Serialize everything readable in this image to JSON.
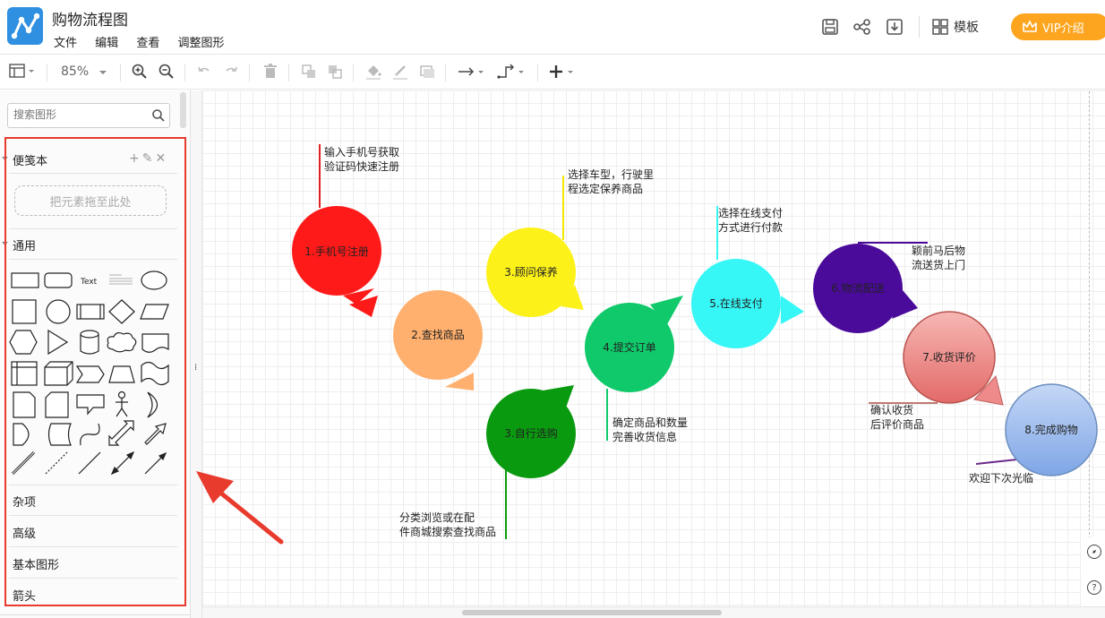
{
  "app": {
    "title": "购物流程图"
  },
  "menu": [
    "文件",
    "编辑",
    "查看",
    "调整图形"
  ],
  "header_actions": {
    "template_label": "模板",
    "vip_label": "VIP介绍"
  },
  "toolbar": {
    "zoom": "85%"
  },
  "sidebar": {
    "search_placeholder": "搜索图形",
    "scratchpad_title": "便笺本",
    "dropzone_text": "把元素拖至此处",
    "general_title": "通用",
    "shape_text_sample": "Text",
    "sections": [
      "杂项",
      "高级",
      "基本图形",
      "箭头"
    ]
  },
  "flow": {
    "steps": [
      {
        "label": "1.手机号注册",
        "color": "#ff1a1a",
        "note": [
          "输入手机号获取",
          "验证码快速注册"
        ]
      },
      {
        "label": "2.查找商品",
        "color": "#ffb06e",
        "note": []
      },
      {
        "label": "3.顾问保养",
        "color": "#fdf11a",
        "note": [
          "选择车型，行驶里",
          "程选定保养商品"
        ]
      },
      {
        "label": "3.自行选购",
        "color": "#0a9a10",
        "note": [
          "分类浏览或在配",
          "件商城搜索查找商品"
        ]
      },
      {
        "label": "4.提交订单",
        "color": "#0fc96a",
        "note": [
          "确定商品和数量",
          "完善收货信息"
        ]
      },
      {
        "label": "5.在线支付",
        "color": "#36f6f6",
        "note": [
          "选择在线支付",
          "方式进行付款"
        ]
      },
      {
        "label": "6.物流配送",
        "color": "#4a0a9a",
        "note": [
          "颖前马后物",
          "流送货上门"
        ]
      },
      {
        "label": "7.收货评价",
        "color": "#ef8a8a",
        "note": [
          "确认收货",
          "后评价商品"
        ]
      },
      {
        "label": "8.完成购物",
        "color": "#9ab8ee",
        "note": [
          "欢迎下次光临"
        ]
      }
    ]
  },
  "canvas_controls": {
    "compass_icon": "compass-icon",
    "help_label": "?"
  },
  "colors": {
    "accent": "#2f8fe0",
    "vip": "#fda51f",
    "highlight": "#e83b2d"
  }
}
